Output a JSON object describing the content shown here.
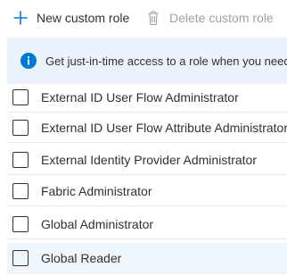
{
  "toolbar": {
    "new_label": "New custom role",
    "delete_label": "Delete custom role"
  },
  "banner": {
    "text": "Get just-in-time access to a role when you need it"
  },
  "roles": [
    {
      "label": "External ID User Flow Administrator"
    },
    {
      "label": "External ID User Flow Attribute Administrator"
    },
    {
      "label": "External Identity Provider Administrator"
    },
    {
      "label": "Fabric Administrator"
    },
    {
      "label": "Global Administrator"
    },
    {
      "label": "Global Reader",
      "selected": true
    }
  ],
  "colors": {
    "accent": "#0078d4",
    "banner_bg": "#ebf2fb",
    "selected_row_bg": "#eff6fc",
    "disabled_text": "#a19f9d"
  }
}
